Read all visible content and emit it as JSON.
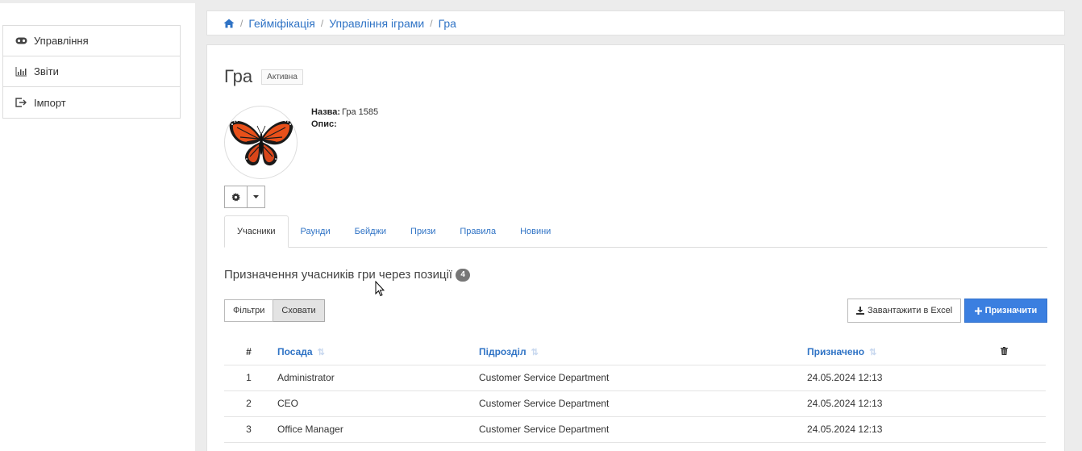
{
  "sidebar": {
    "items": [
      {
        "label": "Управління",
        "icon": "gamepad-icon"
      },
      {
        "label": "Звіти",
        "icon": "chart-icon"
      },
      {
        "label": "Імпорт",
        "icon": "import-icon"
      }
    ]
  },
  "breadcrumb": {
    "items": [
      "Гейміфікація",
      "Управління іграми",
      "Гра"
    ]
  },
  "game": {
    "title": "Гра",
    "status": "Активна",
    "name_label": "Назва:",
    "name_value": "Гра 1585",
    "desc_label": "Опис:",
    "desc_value": ""
  },
  "tabs": [
    "Учасники",
    "Раунди",
    "Бейджи",
    "Призи",
    "Правила",
    "Новини"
  ],
  "section": {
    "title": "Призначення учасників гри через позиції",
    "count": "4"
  },
  "buttons": {
    "filters": "Фільтри",
    "hide": "Сховати",
    "excel": "Завантажити в Excel",
    "assign": "Призначити"
  },
  "table": {
    "headers": {
      "num": "#",
      "position": "Посада",
      "department": "Підрозділ",
      "assigned": "Призначено"
    },
    "rows": [
      {
        "num": "1",
        "position": "Administrator",
        "department": "Customer Service Department",
        "assigned": "24.05.2024 12:13"
      },
      {
        "num": "2",
        "position": "CEO",
        "department": "Customer Service Department",
        "assigned": "24.05.2024 12:13"
      },
      {
        "num": "3",
        "position": "Office Manager",
        "department": "Customer Service Department",
        "assigned": "24.05.2024 12:13"
      }
    ]
  },
  "colors": {
    "accent": "#3b7fe0",
    "link": "#2f73c5"
  }
}
